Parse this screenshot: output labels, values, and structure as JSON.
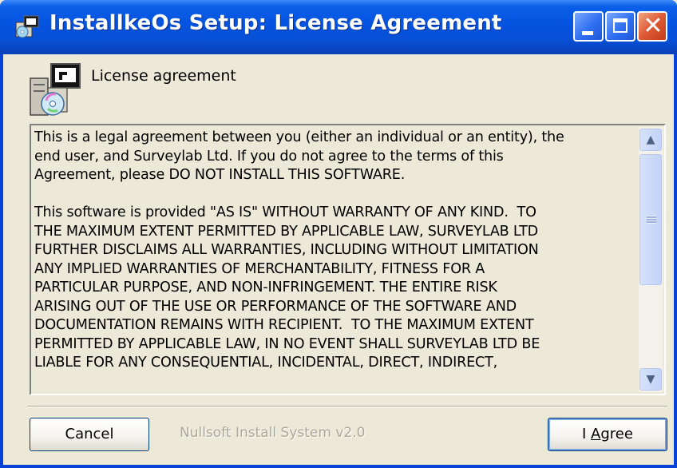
{
  "window": {
    "title": "InstallkeOs Setup: License Agreement"
  },
  "titlebar_buttons": {
    "minimize": "minimize-icon",
    "maximize": "maximize-icon",
    "close": "close-icon",
    "close_glyph": "✕"
  },
  "header": {
    "icon": "installer-package-icon",
    "label": "License agreement"
  },
  "license": {
    "text": "This is a legal agreement between you (either an individual or an entity), the\nend user, and Surveylab Ltd. If you do not agree to the terms of this\nAgreement, please DO NOT INSTALL THIS SOFTWARE.\n\nThis software is provided \"AS IS\" WITHOUT WARRANTY OF ANY KIND.  TO\nTHE MAXIMUM EXTENT PERMITTED BY APPLICABLE LAW, SURVEYLAB LTD\nFURTHER DISCLAIMS ALL WARRANTIES, INCLUDING WITHOUT LIMITATION\nANY IMPLIED WARRANTIES OF MERCHANTABILITY, FITNESS FOR A\nPARTICULAR PURPOSE, AND NON-INFRINGEMENT. THE ENTIRE RISK\nARISING OUT OF THE USE OR PERFORMANCE OF THE SOFTWARE AND\nDOCUMENTATION REMAINS WITH RECIPIENT.  TO THE MAXIMUM EXTENT\nPERMITTED BY APPLICABLE LAW, IN NO EVENT SHALL SURVEYLAB LTD BE\nLIABLE FOR ANY CONSEQUENTIAL, INCIDENTAL, DIRECT, INDIRECT,"
  },
  "scrollbar": {
    "up_icon": "scroll-up-arrow-icon",
    "down_icon": "scroll-down-arrow-icon",
    "up_glyph": "▲",
    "down_glyph": "▼"
  },
  "footer": {
    "cancel_label": "Cancel",
    "branding": "Nullsoft Install System v2.0",
    "agree_label_prefix": "I ",
    "agree_label_accel": "A",
    "agree_label_suffix": "gree"
  },
  "colors": {
    "titlebar": "#0653e0",
    "window_bg": "#ece9d8",
    "close_button": "#dd5a34"
  }
}
